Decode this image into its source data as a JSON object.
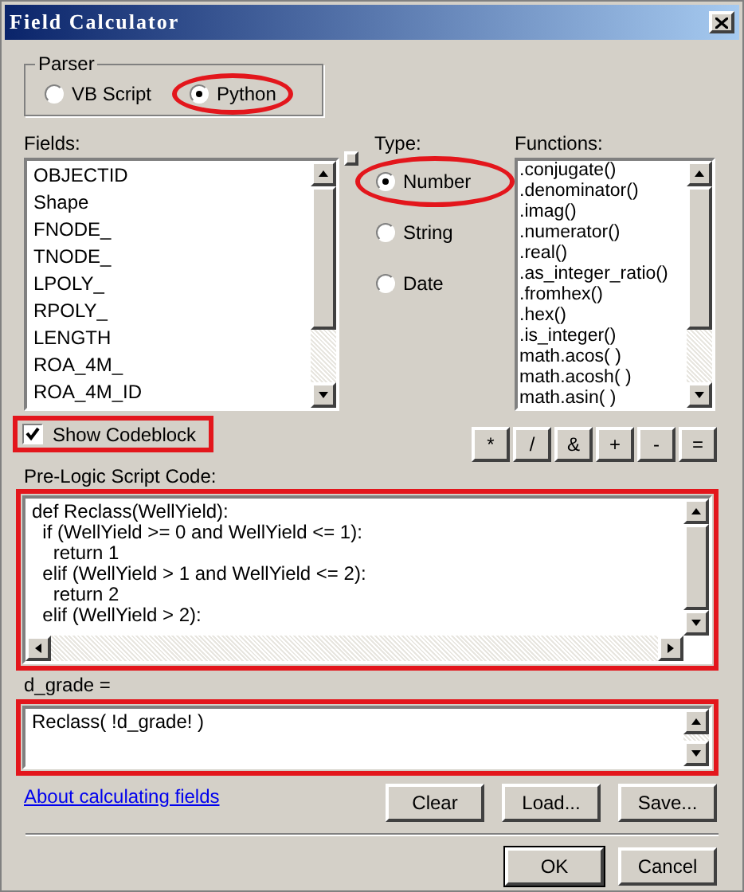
{
  "window": {
    "title": "Field Calculator"
  },
  "parser": {
    "label": "Parser",
    "options": [
      {
        "label": "VB Script",
        "selected": false
      },
      {
        "label": "Python",
        "selected": true
      }
    ]
  },
  "fields": {
    "label": "Fields:",
    "items": [
      "OBJECTID",
      "Shape",
      "FNODE_",
      "TNODE_",
      "LPOLY_",
      "RPOLY_",
      "LENGTH",
      "ROA_4M_",
      "ROA_4M_ID"
    ]
  },
  "type": {
    "label": "Type:",
    "options": [
      {
        "label": "Number",
        "selected": true
      },
      {
        "label": "String",
        "selected": false
      },
      {
        "label": "Date",
        "selected": false
      }
    ]
  },
  "functions": {
    "label": "Functions:",
    "items": [
      ".conjugate()",
      ".denominator()",
      ".imag()",
      ".numerator()",
      ".real()",
      ".as_integer_ratio()",
      ".fromhex()",
      ".hex()",
      ".is_integer()",
      "math.acos( )",
      "math.acosh( )",
      "math.asin( )"
    ]
  },
  "show_codeblock": {
    "label": "Show Codeblock",
    "checked": true
  },
  "operators": [
    "*",
    "/",
    "&",
    "+",
    "-",
    "="
  ],
  "pre_logic": {
    "label": "Pre-Logic Script Code:",
    "lines": [
      "def Reclass(WellYield):",
      "  if (WellYield >= 0 and WellYield <= 1):",
      "    return 1",
      "  elif (WellYield > 1 and WellYield <= 2):",
      "    return 2",
      "  elif (WellYield > 2):"
    ]
  },
  "expression": {
    "label": "d_grade =",
    "value": "Reclass( !d_grade! )"
  },
  "link": "About calculating fields",
  "file_buttons": [
    "Clear",
    "Load...",
    "Save..."
  ],
  "dialog_buttons": [
    {
      "label": "OK",
      "default": true
    },
    {
      "label": "Cancel",
      "default": false
    }
  ]
}
